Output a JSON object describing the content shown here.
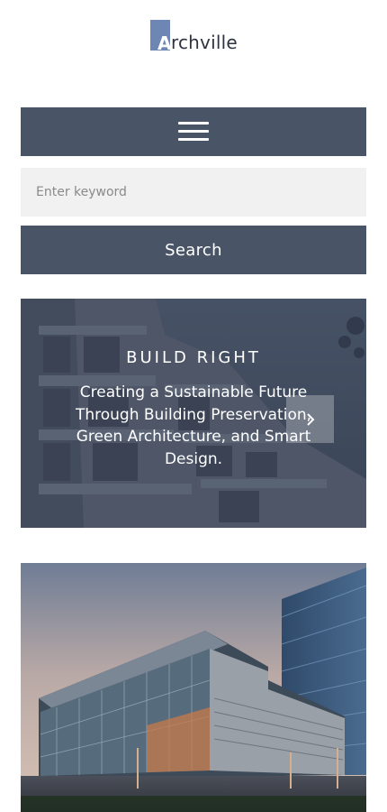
{
  "brand": {
    "logo_letter": "A",
    "logo_rest": "rchville",
    "logo_color": "#6d86b3"
  },
  "nav": {
    "menu_icon": "hamburger-icon"
  },
  "search": {
    "placeholder": "Enter keyword",
    "value": "",
    "button_label": "Search"
  },
  "hero": {
    "title": "BUILD RIGHT",
    "text": "Creating a Sustainable Future Through Building Preservation, Green Architecture, and Smart Design.",
    "next_icon": "chevron-right-icon"
  },
  "colors": {
    "primary": "#4a5467",
    "input_bg": "#f1f1f1",
    "accent": "#6d86b3"
  }
}
